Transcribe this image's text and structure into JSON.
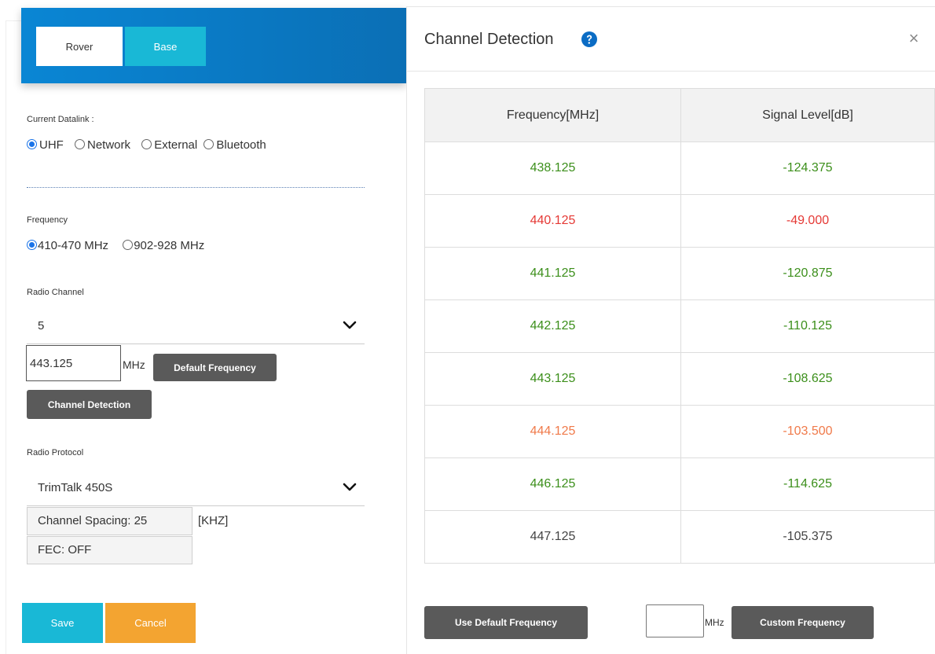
{
  "mode_tabs": {
    "rover": "Rover",
    "base": "Base"
  },
  "datalink": {
    "label": "Current Datalink :",
    "options": [
      {
        "label": "UHF",
        "selected": true
      },
      {
        "label": "Network",
        "selected": false
      },
      {
        "label": "External",
        "selected": false
      },
      {
        "label": "Bluetooth",
        "selected": false
      }
    ]
  },
  "frequency": {
    "label": "Frequency",
    "options": [
      {
        "label": "410-470 MHz",
        "selected": true
      },
      {
        "label": "902-928 MHz",
        "selected": false
      }
    ]
  },
  "radio_channel": {
    "label": "Radio Channel",
    "selected": "5",
    "freq_value": "443.125",
    "unit": "MHz",
    "default_btn": "Default Frequency",
    "detect_btn": "Channel Detection"
  },
  "radio_protocol": {
    "label": "Radio Protocol",
    "selected": "TrimTalk 450S",
    "channel_spacing": "Channel Spacing: 25",
    "spacing_unit": "[KHZ]",
    "fec": "FEC: OFF"
  },
  "actions": {
    "save": "Save",
    "cancel": "Cancel"
  },
  "modal": {
    "title": "Channel Detection",
    "close": "×",
    "columns": [
      "Frequency[MHz]",
      "Signal Level[dB]"
    ],
    "rows": [
      {
        "freq": "438.125",
        "level": "-124.375",
        "color": "#3c8f1b"
      },
      {
        "freq": "440.125",
        "level": "-49.000",
        "color": "#e53935"
      },
      {
        "freq": "441.125",
        "level": "-120.875",
        "color": "#3c8f1b"
      },
      {
        "freq": "442.125",
        "level": "-110.125",
        "color": "#3c8f1b"
      },
      {
        "freq": "443.125",
        "level": "-108.625",
        "color": "#3c8f1b"
      },
      {
        "freq": "444.125",
        "level": "-103.500",
        "color": "#f07a4a"
      },
      {
        "freq": "446.125",
        "level": "-114.625",
        "color": "#3c8f1b"
      },
      {
        "freq": "447.125",
        "level": "-105.375",
        "color": "#444444"
      }
    ],
    "use_default_btn": "Use Default Frequency",
    "custom_value": "",
    "custom_unit": "MHz",
    "custom_btn": "Custom Frequency"
  },
  "colors": {
    "header_blue": "#0a86d4",
    "accent_cyan": "#19b8d6",
    "cancel_orange": "#f3a431",
    "dark_button": "#5a5a5a",
    "radio_blue": "#1a73e8"
  }
}
